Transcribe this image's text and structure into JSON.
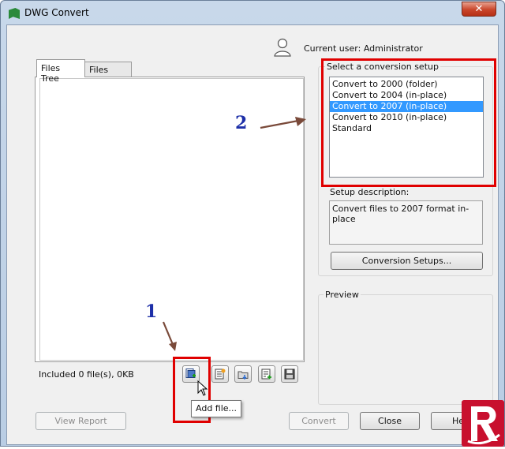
{
  "window": {
    "title": "DWG Convert",
    "close_glyph": "✕"
  },
  "user": {
    "label": "Current user: Administrator",
    "icon": "user-icon"
  },
  "tabs": [
    {
      "label": "Files Tree",
      "active": true
    },
    {
      "label": "Files Table",
      "active": false
    }
  ],
  "files": {
    "status": "Included 0 file(s), 0KB"
  },
  "toolbar": {
    "items": [
      {
        "icon": "add-file-icon"
      },
      {
        "icon": "add-sheet-list-icon"
      },
      {
        "icon": "add-folder-icon"
      },
      {
        "icon": "add-list-icon"
      },
      {
        "icon": "save-icon"
      }
    ],
    "tooltip": "Add file..."
  },
  "setup": {
    "label": "Select a conversion setup",
    "items": [
      "Convert to 2000 (folder)",
      "Convert to 2004 (in-place)",
      "Convert to 2007 (in-place)",
      "Convert to 2010 (in-place)",
      "Standard"
    ],
    "selected_index": 2,
    "description_label": "Setup description:",
    "description": "Convert files to 2007 format in-place",
    "setups_button": "Conversion Setups..."
  },
  "preview": {
    "label": "Preview"
  },
  "buttons": {
    "view_report": "View Report",
    "convert": "Convert",
    "close": "Close",
    "help": "He"
  },
  "annotations": {
    "one": "1",
    "two": "2"
  },
  "colors": {
    "highlight": "#e00000",
    "selection": "#3399ff",
    "annotation": "#1d2fa8"
  }
}
